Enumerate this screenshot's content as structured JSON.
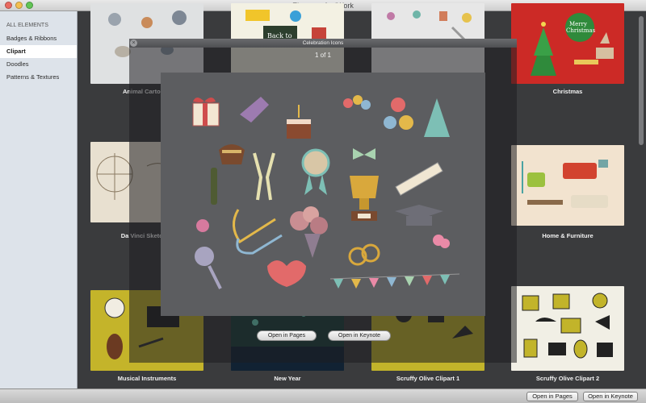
{
  "window": {
    "title": "Elements for iWork"
  },
  "sidebar": {
    "items": [
      {
        "label": "ALL ELEMENTS"
      },
      {
        "label": "Badges & Ribbons"
      },
      {
        "label": "Clipart"
      },
      {
        "label": "Doodles"
      },
      {
        "label": "Patterns & Textures"
      }
    ],
    "selected": "Clipart"
  },
  "grid": {
    "items": [
      {
        "label": "Animal Cartoons"
      },
      {
        "label": ""
      },
      {
        "label": ""
      },
      {
        "label": "Christmas"
      },
      {
        "label": "Da Vinci Sketches"
      },
      {
        "label": "Home & Furniture"
      },
      {
        "label": "Musical Instruments"
      },
      {
        "label": "New Year"
      },
      {
        "label": "Scruffy Olive Clipart 1"
      },
      {
        "label": "Scruffy Olive Clipart 2"
      }
    ]
  },
  "popover": {
    "title": "Celebration Icons",
    "counter": "1 of 1",
    "open_pages": "Open in Pages",
    "open_keynote": "Open in Keynote"
  },
  "bottombar": {
    "open_pages": "Open in Pages",
    "open_keynote": "Open in Keynote"
  },
  "colors": {
    "accent_red": "#cc2a26",
    "olive": "#c2b42a",
    "panel": "#5c5d60"
  }
}
